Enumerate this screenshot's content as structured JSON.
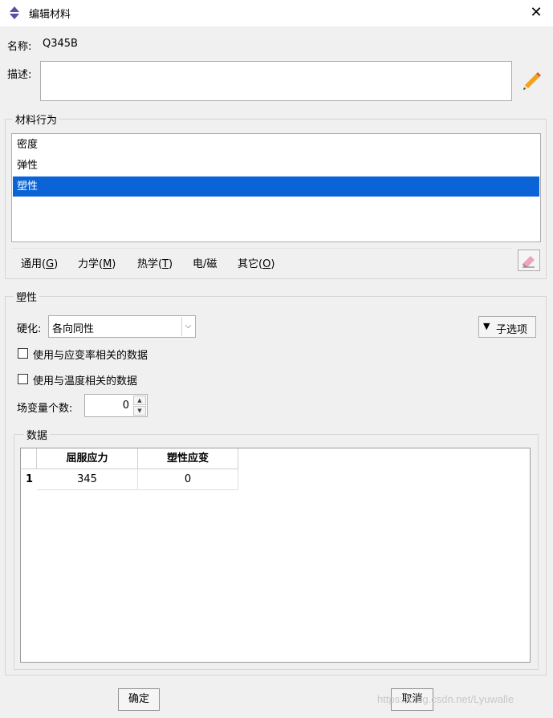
{
  "window": {
    "title": "编辑材料"
  },
  "name_label": "名称:",
  "name_value": "Q345B",
  "description_label": "描述:",
  "behavior_group": {
    "title": "材料行为",
    "items": [
      "密度",
      "弹性",
      "塑性"
    ],
    "selected_index": 2
  },
  "menu": [
    {
      "text": "通用(",
      "key": "G",
      "end": ")"
    },
    {
      "text": "力学(",
      "key": "M",
      "end": ")"
    },
    {
      "text": "热学(",
      "key": "T",
      "end": ")"
    },
    {
      "text": "电/磁",
      "key": "",
      "end": ""
    },
    {
      "text": "其它(",
      "key": "O",
      "end": ")"
    }
  ],
  "plasticity": {
    "title": "塑性",
    "hardening_label": "硬化:",
    "hardening_value": "各向同性",
    "suboptions_label": "子选项",
    "checkbox_rate": "使用与应变率相关的数据",
    "checkbox_temp": "使用与温度相关的数据",
    "field_vars_label": "场变量个数:",
    "field_vars_value": "0"
  },
  "data_group": {
    "title": "数据",
    "columns": [
      "屈服应力",
      "塑性应变"
    ],
    "rows": [
      {
        "num": "1",
        "cells": [
          "345",
          "0"
        ]
      }
    ]
  },
  "buttons": {
    "ok": "确定",
    "cancel": "取消"
  },
  "watermark": "https://blog.csdn.net/Lyuwalle"
}
